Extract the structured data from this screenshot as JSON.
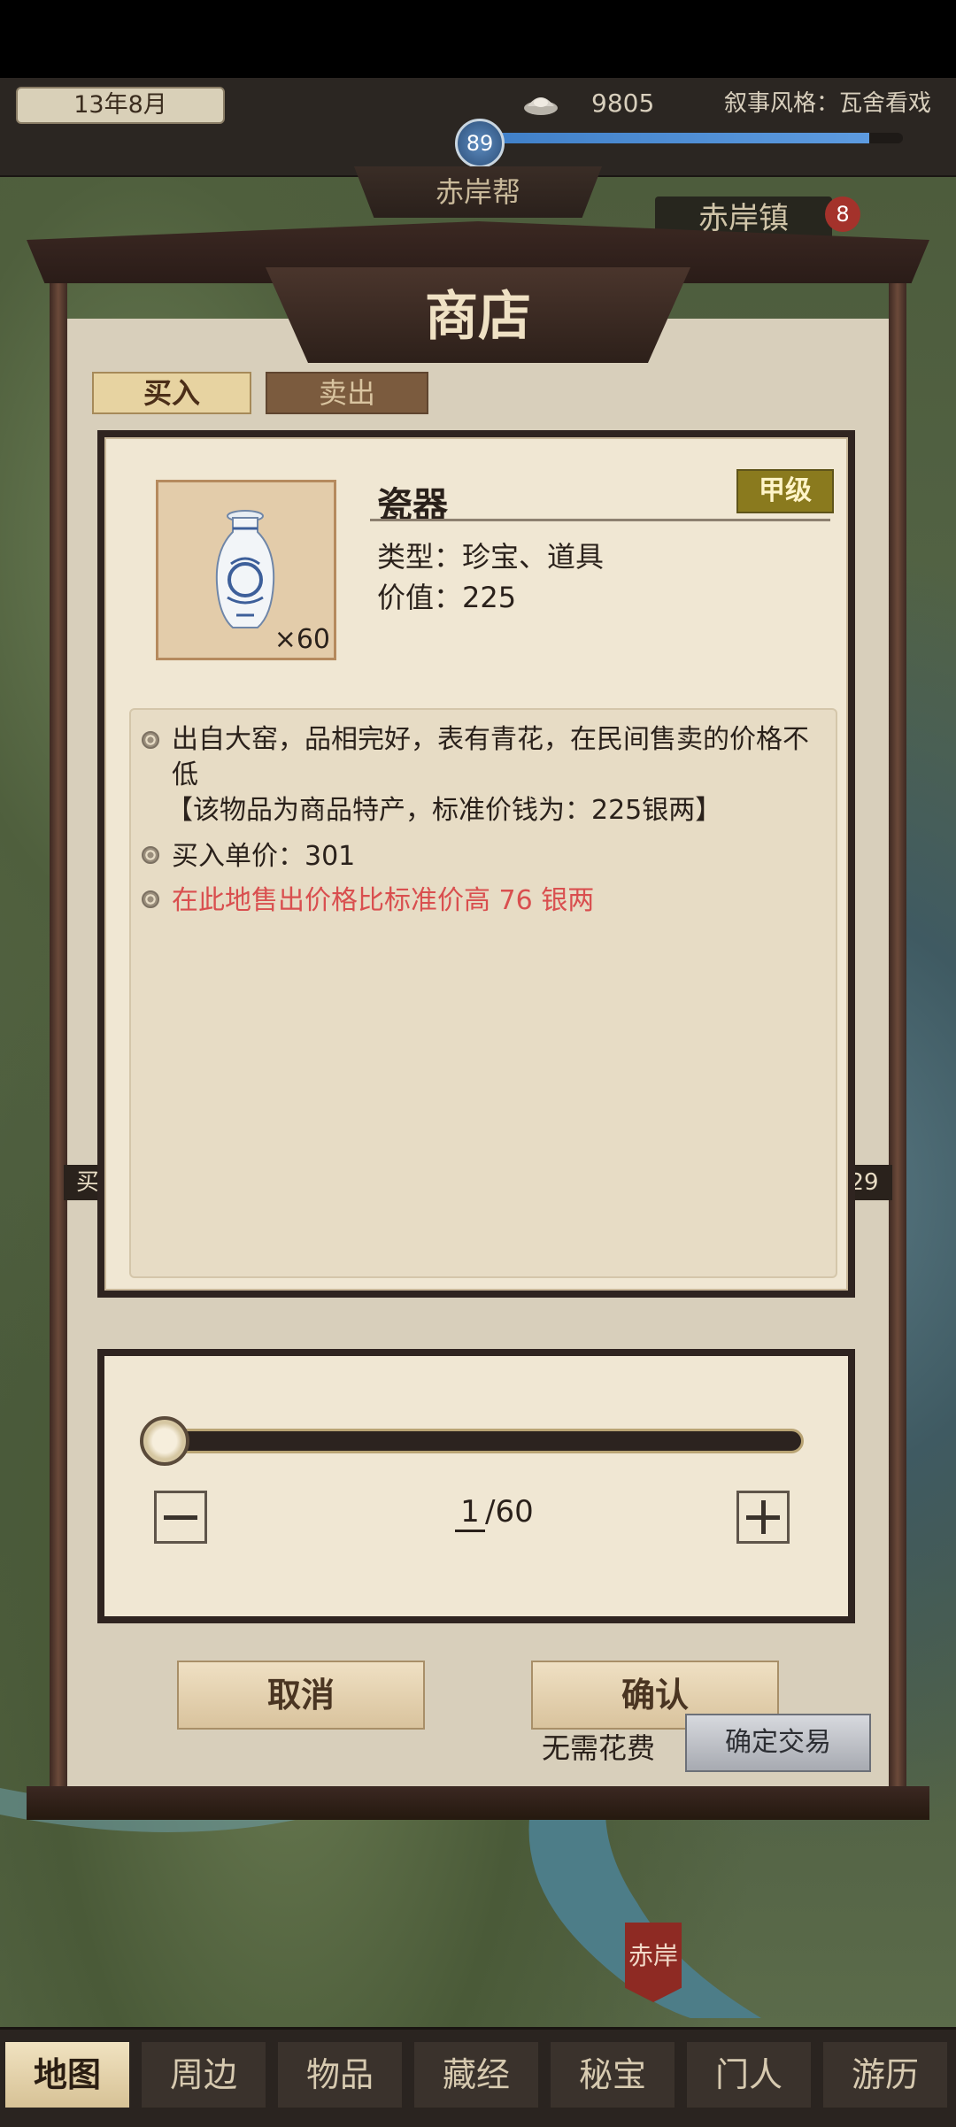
{
  "top_bar": {
    "date": "13年8月",
    "silver": "9805",
    "narrative_style": "叙事风格：瓦舍看戏",
    "level": "89",
    "xp_progress": 0.92
  },
  "map": {
    "sect_banner": "赤岸帮",
    "town_name": "赤岸镇",
    "town_badge": "8",
    "bottom_town": "赤岸",
    "row_label_left": "买",
    "row_label_right": "29"
  },
  "shop": {
    "title": "商店",
    "tab_buy": "买入",
    "tab_sell": "卖出"
  },
  "item": {
    "name": "瓷器",
    "grade": "甲级",
    "type": "类型：珍宝、道具",
    "value": "价值：225",
    "quantity_badge": "×60",
    "description": "出自大窑，品相完好，表有青花，在民间售卖的价格不低",
    "note": "【该物品为商品特产，标准价钱为：225银两】",
    "buy_price": "买入单价：301",
    "premium": "在此地售出价格比标准价高 76 银两"
  },
  "quantity": {
    "current": "1",
    "total": "/60",
    "fraction": 0.0167
  },
  "actions": {
    "cancel": "取消",
    "confirm": "确认",
    "no_cost": "无需花费",
    "deal": "确定交易"
  },
  "nav": {
    "items": [
      "地图",
      "周边",
      "物品",
      "藏经",
      "秘宝",
      "门人",
      "游历"
    ]
  }
}
